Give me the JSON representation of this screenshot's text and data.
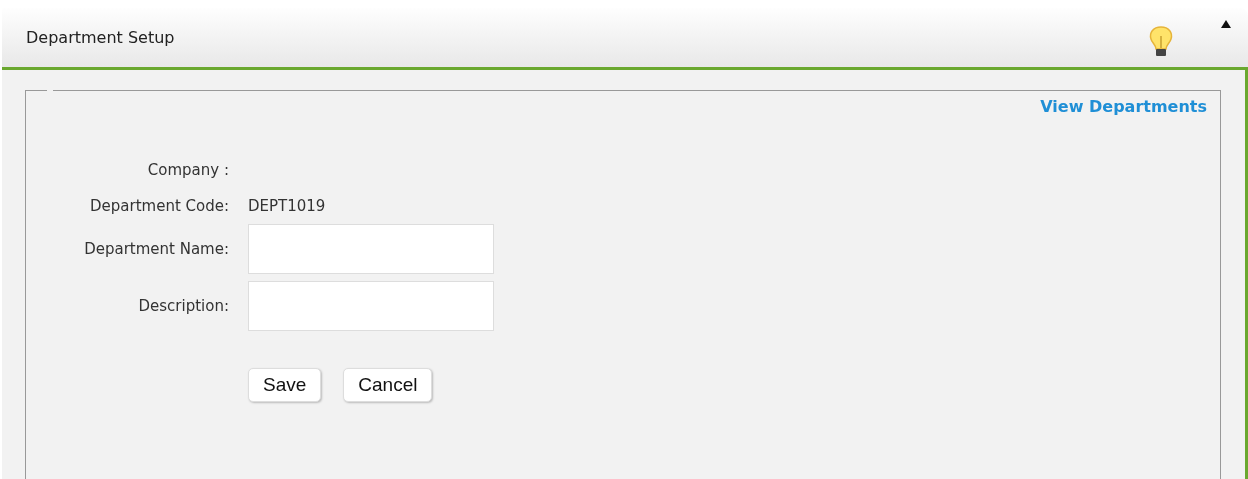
{
  "header": {
    "title": "Department Setup"
  },
  "link": "View Departments",
  "fields": [
    {
      "kind": "text",
      "label": "Company :"
    },
    {
      "kind": "text",
      "label": "Department Code:",
      "value": "DEPT1019"
    },
    {
      "kind": "input",
      "label": "Department Name:"
    },
    {
      "kind": "input",
      "label": "Description:"
    }
  ],
  "buttons": [
    "Save",
    "Cancel"
  ]
}
